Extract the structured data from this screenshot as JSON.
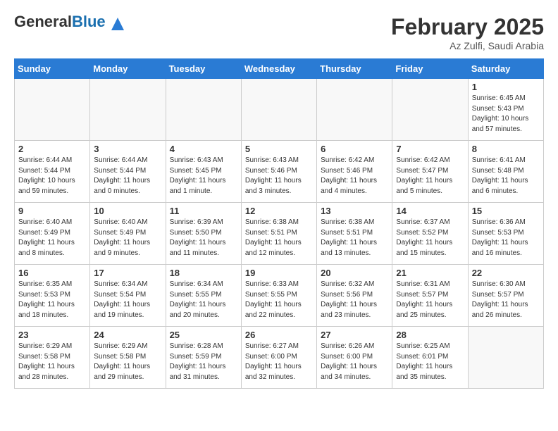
{
  "header": {
    "logo_general": "General",
    "logo_blue": "Blue",
    "title": "February 2025",
    "subtitle": "Az Zulfi, Saudi Arabia"
  },
  "weekdays": [
    "Sunday",
    "Monday",
    "Tuesday",
    "Wednesday",
    "Thursday",
    "Friday",
    "Saturday"
  ],
  "weeks": [
    [
      {
        "day": "",
        "info": ""
      },
      {
        "day": "",
        "info": ""
      },
      {
        "day": "",
        "info": ""
      },
      {
        "day": "",
        "info": ""
      },
      {
        "day": "",
        "info": ""
      },
      {
        "day": "",
        "info": ""
      },
      {
        "day": "1",
        "info": "Sunrise: 6:45 AM\nSunset: 5:43 PM\nDaylight: 10 hours and 57 minutes."
      }
    ],
    [
      {
        "day": "2",
        "info": "Sunrise: 6:44 AM\nSunset: 5:44 PM\nDaylight: 10 hours and 59 minutes."
      },
      {
        "day": "3",
        "info": "Sunrise: 6:44 AM\nSunset: 5:44 PM\nDaylight: 11 hours and 0 minutes."
      },
      {
        "day": "4",
        "info": "Sunrise: 6:43 AM\nSunset: 5:45 PM\nDaylight: 11 hours and 1 minute."
      },
      {
        "day": "5",
        "info": "Sunrise: 6:43 AM\nSunset: 5:46 PM\nDaylight: 11 hours and 3 minutes."
      },
      {
        "day": "6",
        "info": "Sunrise: 6:42 AM\nSunset: 5:46 PM\nDaylight: 11 hours and 4 minutes."
      },
      {
        "day": "7",
        "info": "Sunrise: 6:42 AM\nSunset: 5:47 PM\nDaylight: 11 hours and 5 minutes."
      },
      {
        "day": "8",
        "info": "Sunrise: 6:41 AM\nSunset: 5:48 PM\nDaylight: 11 hours and 6 minutes."
      }
    ],
    [
      {
        "day": "9",
        "info": "Sunrise: 6:40 AM\nSunset: 5:49 PM\nDaylight: 11 hours and 8 minutes."
      },
      {
        "day": "10",
        "info": "Sunrise: 6:40 AM\nSunset: 5:49 PM\nDaylight: 11 hours and 9 minutes."
      },
      {
        "day": "11",
        "info": "Sunrise: 6:39 AM\nSunset: 5:50 PM\nDaylight: 11 hours and 11 minutes."
      },
      {
        "day": "12",
        "info": "Sunrise: 6:38 AM\nSunset: 5:51 PM\nDaylight: 11 hours and 12 minutes."
      },
      {
        "day": "13",
        "info": "Sunrise: 6:38 AM\nSunset: 5:51 PM\nDaylight: 11 hours and 13 minutes."
      },
      {
        "day": "14",
        "info": "Sunrise: 6:37 AM\nSunset: 5:52 PM\nDaylight: 11 hours and 15 minutes."
      },
      {
        "day": "15",
        "info": "Sunrise: 6:36 AM\nSunset: 5:53 PM\nDaylight: 11 hours and 16 minutes."
      }
    ],
    [
      {
        "day": "16",
        "info": "Sunrise: 6:35 AM\nSunset: 5:53 PM\nDaylight: 11 hours and 18 minutes."
      },
      {
        "day": "17",
        "info": "Sunrise: 6:34 AM\nSunset: 5:54 PM\nDaylight: 11 hours and 19 minutes."
      },
      {
        "day": "18",
        "info": "Sunrise: 6:34 AM\nSunset: 5:55 PM\nDaylight: 11 hours and 20 minutes."
      },
      {
        "day": "19",
        "info": "Sunrise: 6:33 AM\nSunset: 5:55 PM\nDaylight: 11 hours and 22 minutes."
      },
      {
        "day": "20",
        "info": "Sunrise: 6:32 AM\nSunset: 5:56 PM\nDaylight: 11 hours and 23 minutes."
      },
      {
        "day": "21",
        "info": "Sunrise: 6:31 AM\nSunset: 5:57 PM\nDaylight: 11 hours and 25 minutes."
      },
      {
        "day": "22",
        "info": "Sunrise: 6:30 AM\nSunset: 5:57 PM\nDaylight: 11 hours and 26 minutes."
      }
    ],
    [
      {
        "day": "23",
        "info": "Sunrise: 6:29 AM\nSunset: 5:58 PM\nDaylight: 11 hours and 28 minutes."
      },
      {
        "day": "24",
        "info": "Sunrise: 6:29 AM\nSunset: 5:58 PM\nDaylight: 11 hours and 29 minutes."
      },
      {
        "day": "25",
        "info": "Sunrise: 6:28 AM\nSunset: 5:59 PM\nDaylight: 11 hours and 31 minutes."
      },
      {
        "day": "26",
        "info": "Sunrise: 6:27 AM\nSunset: 6:00 PM\nDaylight: 11 hours and 32 minutes."
      },
      {
        "day": "27",
        "info": "Sunrise: 6:26 AM\nSunset: 6:00 PM\nDaylight: 11 hours and 34 minutes."
      },
      {
        "day": "28",
        "info": "Sunrise: 6:25 AM\nSunset: 6:01 PM\nDaylight: 11 hours and 35 minutes."
      },
      {
        "day": "",
        "info": ""
      }
    ]
  ]
}
